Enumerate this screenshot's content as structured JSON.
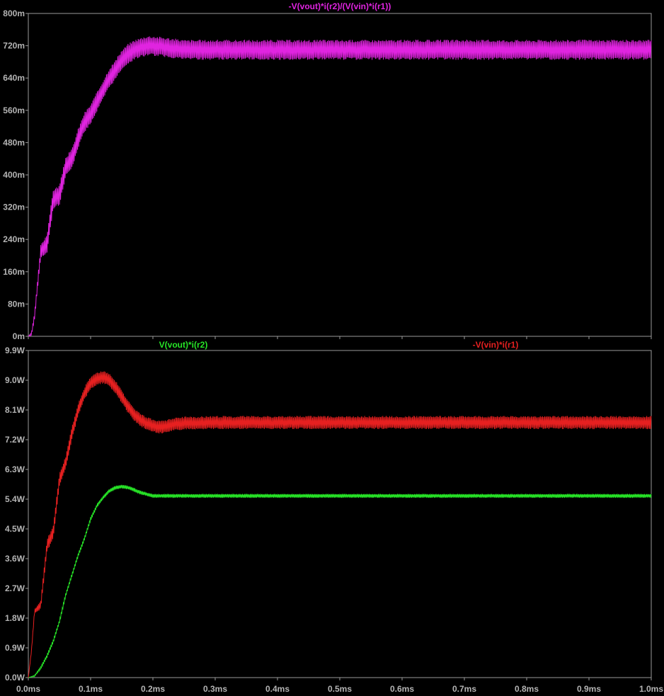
{
  "chart_data": [
    {
      "type": "line",
      "title": "",
      "xlabel": "",
      "ylabel": "",
      "xlim": [
        0,
        1.0
      ],
      "ylim": [
        0,
        0.8
      ],
      "grid": false,
      "legend": "top-center",
      "x_ticks": [
        "0.0ms",
        "0.1ms",
        "0.2ms",
        "0.3ms",
        "0.4ms",
        "0.5ms",
        "0.6ms",
        "0.7ms",
        "0.8ms",
        "0.9ms",
        "1.0ms"
      ],
      "y_ticks": [
        "0m",
        "80m",
        "160m",
        "240m",
        "320m",
        "400m",
        "480m",
        "560m",
        "640m",
        "720m",
        "800m"
      ],
      "series": [
        {
          "name": "-V(vout)*i(r2)/(V(vin)*i(r1))",
          "color": "#e024e0",
          "x": [
            0.0,
            0.005,
            0.01,
            0.015,
            0.02,
            0.03,
            0.04,
            0.05,
            0.06,
            0.07,
            0.08,
            0.09,
            0.1,
            0.11,
            0.12,
            0.13,
            0.14,
            0.15,
            0.16,
            0.17,
            0.18,
            0.19,
            0.2,
            0.25,
            0.3,
            0.4,
            0.5,
            0.6,
            0.7,
            0.8,
            0.9,
            1.0
          ],
          "values": [
            0.0,
            0.005,
            0.05,
            0.13,
            0.21,
            0.23,
            0.34,
            0.35,
            0.42,
            0.44,
            0.49,
            0.53,
            0.55,
            0.58,
            0.61,
            0.64,
            0.66,
            0.685,
            0.7,
            0.71,
            0.715,
            0.72,
            0.72,
            0.71,
            0.71,
            0.71,
            0.71,
            0.71,
            0.71,
            0.71,
            0.71,
            0.71
          ],
          "ripple_amplitude": 0.025
        }
      ]
    },
    {
      "type": "line",
      "title": "",
      "xlabel": "",
      "ylabel": "",
      "xlim": [
        0,
        1.0
      ],
      "ylim": [
        0,
        9.9
      ],
      "grid": false,
      "legend": "top",
      "x_ticks": [
        "0.0ms",
        "0.1ms",
        "0.2ms",
        "0.3ms",
        "0.4ms",
        "0.5ms",
        "0.6ms",
        "0.7ms",
        "0.8ms",
        "0.9ms",
        "1.0ms"
      ],
      "y_ticks": [
        "0.0W",
        "0.9W",
        "1.8W",
        "2.7W",
        "3.6W",
        "4.5W",
        "5.4W",
        "6.3W",
        "7.2W",
        "8.1W",
        "9.0W",
        "9.9W"
      ],
      "series": [
        {
          "name": "V(vout)*i(r2)",
          "color": "#27e627",
          "x": [
            0.0,
            0.01,
            0.02,
            0.03,
            0.04,
            0.05,
            0.06,
            0.07,
            0.08,
            0.09,
            0.1,
            0.11,
            0.12,
            0.13,
            0.14,
            0.15,
            0.16,
            0.17,
            0.18,
            0.19,
            0.2,
            0.22,
            0.25,
            0.3,
            0.4,
            0.5,
            0.6,
            0.7,
            0.8,
            0.9,
            1.0
          ],
          "values": [
            0.0,
            0.05,
            0.3,
            0.65,
            1.1,
            1.7,
            2.5,
            3.1,
            3.7,
            4.2,
            4.8,
            5.2,
            5.45,
            5.65,
            5.75,
            5.78,
            5.75,
            5.68,
            5.6,
            5.55,
            5.5,
            5.5,
            5.5,
            5.5,
            5.5,
            5.5,
            5.5,
            5.5,
            5.5,
            5.5,
            5.5
          ],
          "ripple_amplitude": 0.06
        },
        {
          "name": "-V(vin)*i(r1)",
          "color": "#e62020",
          "x": [
            0.0,
            0.005,
            0.01,
            0.015,
            0.02,
            0.03,
            0.04,
            0.05,
            0.06,
            0.07,
            0.08,
            0.09,
            0.1,
            0.11,
            0.12,
            0.13,
            0.14,
            0.15,
            0.16,
            0.17,
            0.18,
            0.19,
            0.2,
            0.21,
            0.22,
            0.23,
            0.25,
            0.3,
            0.4,
            0.5,
            0.6,
            0.7,
            0.8,
            0.9,
            1.0
          ],
          "values": [
            0.0,
            0.8,
            2.0,
            2.1,
            2.2,
            4.0,
            4.4,
            6.0,
            6.5,
            7.4,
            8.1,
            8.6,
            8.9,
            9.05,
            9.1,
            9.0,
            8.8,
            8.5,
            8.2,
            7.95,
            7.8,
            7.7,
            7.62,
            7.58,
            7.6,
            7.66,
            7.7,
            7.72,
            7.72,
            7.72,
            7.72,
            7.72,
            7.72,
            7.72,
            7.72
          ],
          "ripple_amplitude": 0.2
        }
      ]
    }
  ]
}
